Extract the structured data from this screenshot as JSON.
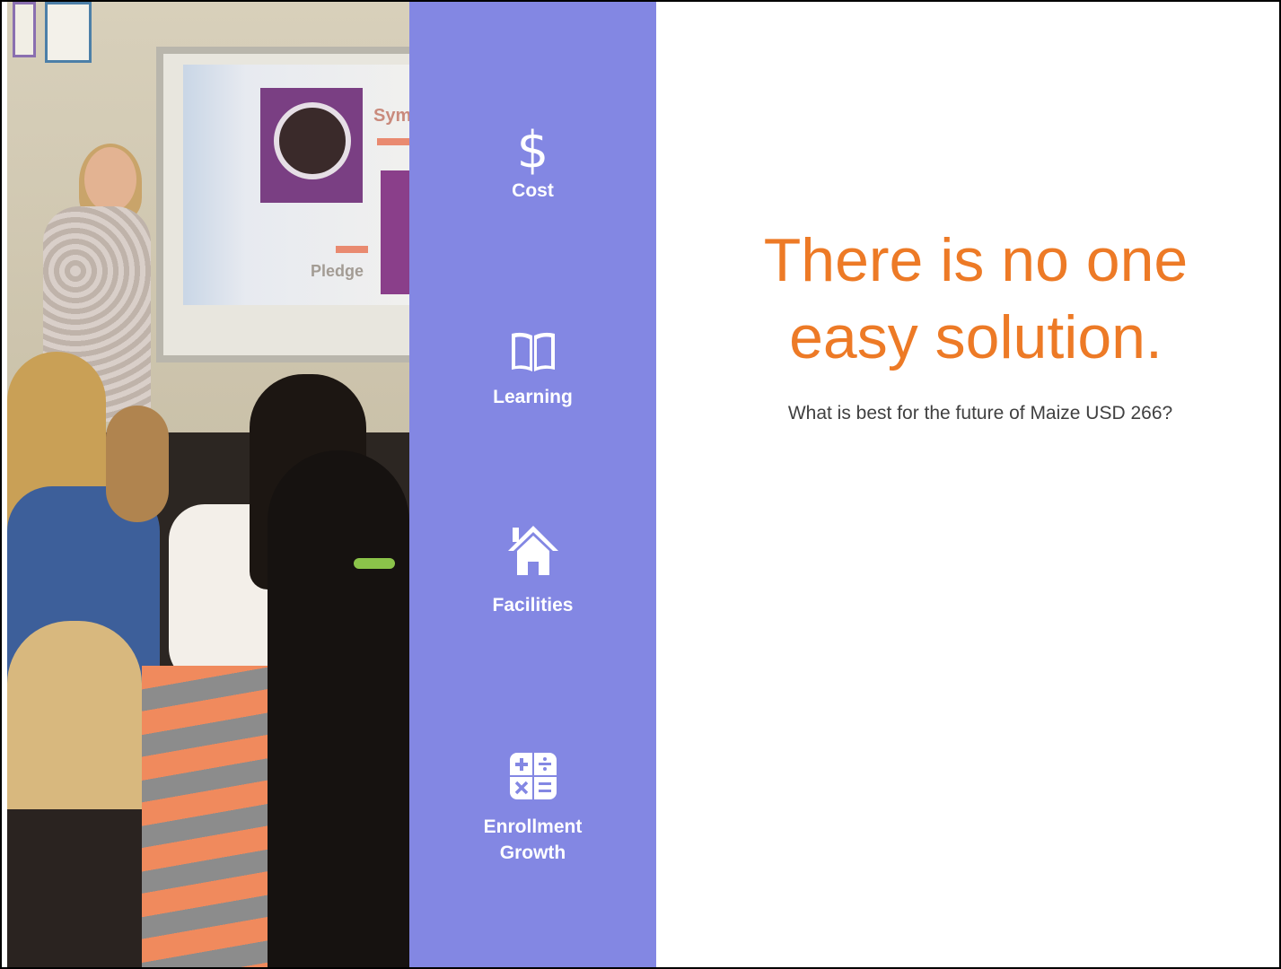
{
  "slide": {
    "title_line1": "There is no one",
    "title_line2": "easy solution.",
    "subtitle": "What is best for the future of Maize USD 266?",
    "colors": {
      "title": "#ed7a26",
      "sidebar_bg": "#8387e3",
      "subtitle": "#404040"
    }
  },
  "photo": {
    "description_icon": "classroom-photo",
    "screen_text_sym": "Sym",
    "screen_text_pledge": "Pledge"
  },
  "sidebar": {
    "items": [
      {
        "label": "Cost",
        "icon": "dollar-icon",
        "glyph": "$"
      },
      {
        "label": "Learning",
        "icon": "book-icon"
      },
      {
        "label": "Facilities",
        "icon": "house-icon"
      },
      {
        "label_line1": "Enrollment",
        "label_line2": "Growth",
        "icon": "calculator-icon"
      }
    ]
  }
}
